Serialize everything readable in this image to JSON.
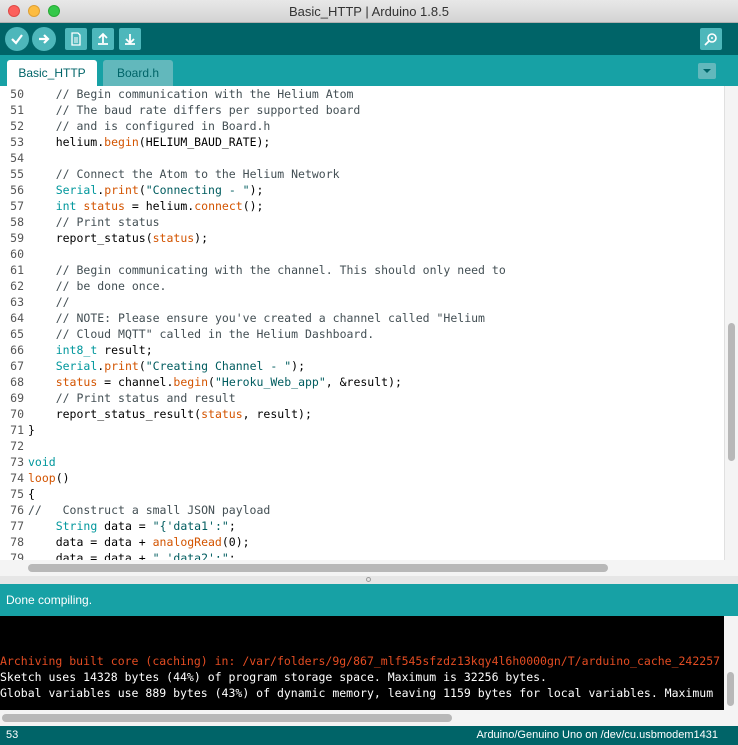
{
  "window": {
    "title": "Basic_HTTP | Arduino 1.8.5"
  },
  "toolbar": {
    "buttons": [
      {
        "name": "verify-button",
        "icon": "checkmark-icon"
      },
      {
        "name": "upload-button",
        "icon": "arrow-right-icon"
      },
      {
        "name": "new-button",
        "icon": "new-file-icon"
      },
      {
        "name": "open-button",
        "icon": "arrow-up-icon"
      },
      {
        "name": "save-button",
        "icon": "arrow-down-icon"
      }
    ],
    "serial_monitor_icon": "magnifier-icon"
  },
  "tabs": [
    {
      "label": "Basic_HTTP",
      "active": true
    },
    {
      "label": "Board.h",
      "active": false
    }
  ],
  "editor": {
    "lines": [
      {
        "n": "50",
        "text": "    // Begin communication with the Helium Atom"
      },
      {
        "n": "51",
        "text": "    // The baud rate differs per supported board"
      },
      {
        "n": "52",
        "text": "    // and is configured in Board.h"
      },
      {
        "n": "53",
        "text": "    helium.begin(HELIUM_BAUD_RATE);"
      },
      {
        "n": "54",
        "text": ""
      },
      {
        "n": "55",
        "text": "    // Connect the Atom to the Helium Network"
      },
      {
        "n": "56",
        "text": "    Serial.print(\"Connecting - \");"
      },
      {
        "n": "57",
        "text": "    int status = helium.connect();"
      },
      {
        "n": "58",
        "text": "    // Print status"
      },
      {
        "n": "59",
        "text": "    report_status(status);"
      },
      {
        "n": "60",
        "text": ""
      },
      {
        "n": "61",
        "text": "    // Begin communicating with the channel. This should only need to"
      },
      {
        "n": "62",
        "text": "    // be done once."
      },
      {
        "n": "63",
        "text": "    //"
      },
      {
        "n": "64",
        "text": "    // NOTE: Please ensure you've created a channel called \"Helium"
      },
      {
        "n": "65",
        "text": "    // Cloud MQTT\" called in the Helium Dashboard."
      },
      {
        "n": "66",
        "text": "    int8_t result;"
      },
      {
        "n": "67",
        "text": "    Serial.print(\"Creating Channel - \");"
      },
      {
        "n": "68",
        "text": "    status = channel.begin(\"Heroku_Web_app\", &result);"
      },
      {
        "n": "69",
        "text": "    // Print status and result"
      },
      {
        "n": "70",
        "text": "    report_status_result(status, result);"
      },
      {
        "n": "71",
        "text": "}"
      },
      {
        "n": "72",
        "text": ""
      },
      {
        "n": "73",
        "text": "void"
      },
      {
        "n": "74",
        "text": "loop()"
      },
      {
        "n": "75",
        "text": "{"
      },
      {
        "n": "76",
        "text": "//   Construct a small JSON payload"
      },
      {
        "n": "77",
        "text": "    String data = \"{'data1':\";"
      },
      {
        "n": "78",
        "text": "    data = data + analogRead(0);"
      },
      {
        "n": "79",
        "text": "    data = data + \",'data2':\";"
      }
    ]
  },
  "status_bar": {
    "message": "Done compiling."
  },
  "console": {
    "lines": [
      {
        "text": "",
        "color": "white"
      },
      {
        "text": "",
        "color": "white"
      },
      {
        "text": "Archiving built core (caching) in: /var/folders/9g/867_mlf545sfzdz13kqy4l6h0000gn/T/arduino_cache_242257",
        "color": "orange"
      },
      {
        "text": "Sketch uses 14328 bytes (44%) of program storage space. Maximum is 32256 bytes.",
        "color": "white"
      },
      {
        "text": "Global variables use 889 bytes (43%) of dynamic memory, leaving 1159 bytes for local variables. Maximum",
        "color": "white"
      }
    ]
  },
  "footer": {
    "line_number": "53",
    "board": "Arduino/Genuino Uno on /dev/cu.usbmodem1431"
  },
  "colors": {
    "toolbar": "#006468",
    "tabbar": "#17a1a5",
    "keyword": "#00979c",
    "function": "#d35400",
    "console_error": "#e34c22"
  }
}
